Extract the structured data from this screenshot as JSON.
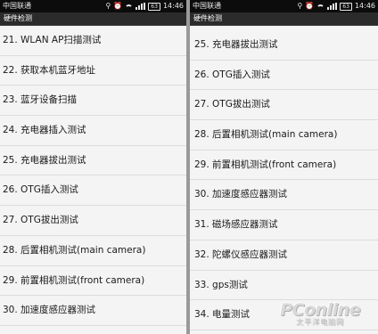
{
  "screens": [
    {
      "status": {
        "carrier": "中国联通",
        "battery": "63",
        "time": "14:46"
      },
      "title": "硬件检测",
      "items": [
        "21. WLAN AP扫描测试",
        "22. 获取本机蓝牙地址",
        "23. 蓝牙设备扫描",
        "24. 充电器插入测试",
        "25. 充电器拔出测试",
        "26. OTG插入测试",
        "27. OTG拔出测试",
        "28. 后置相机测试(main camera)",
        "29. 前置相机测试(front camera)",
        "30. 加速度感应器测试"
      ]
    },
    {
      "status": {
        "carrier": "中国联通",
        "battery": "63",
        "time": "14:46"
      },
      "title": "硬件检测",
      "items": [
        "25. 充电器拔出测试",
        "26. OTG插入测试",
        "27. OTG拔出测试",
        "28. 后置相机测试(main camera)",
        "29. 前置相机测试(front camera)",
        "30. 加速度感应器测试",
        "31. 磁场感应器测试",
        "32. 陀螺仪感应器测试",
        "33. gps测试",
        "34. 电量测试"
      ]
    }
  ],
  "watermark": {
    "logo": "PConline",
    "sub": "太平洋电脑网"
  }
}
